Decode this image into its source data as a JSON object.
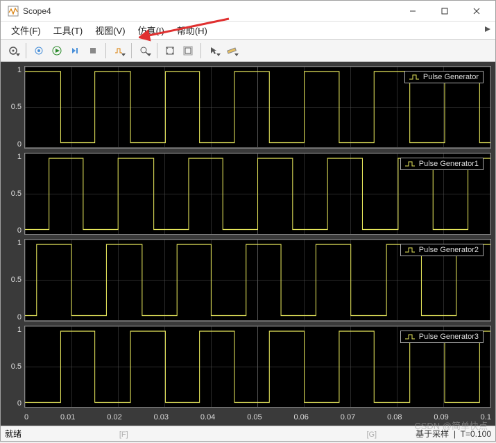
{
  "window": {
    "title": "Scope4"
  },
  "menu": {
    "file": "文件(F)",
    "tools": "工具(T)",
    "view": "视图(V)",
    "sim": "仿真(I)",
    "help": "帮助(H)"
  },
  "toolbar": {
    "config": "gear",
    "print": "print",
    "run": "run",
    "step": "step-fwd",
    "stop": "stop",
    "highlight": "highlight",
    "zoom": "zoom",
    "autoscale": "autoscale",
    "cursor": "cursor",
    "measure": "measure",
    "snapshot": "snapshot"
  },
  "status": {
    "left": "就绪",
    "right_mode": "基于采样",
    "right_time": "T=0.100"
  },
  "chart_data": [
    {
      "type": "line",
      "legend": "Pulse Generator",
      "ylim": [
        0,
        1
      ],
      "yticks": [
        0,
        0.5,
        1
      ],
      "xlim": [
        0,
        0.1
      ],
      "period": 0.015,
      "duty": 0.5,
      "phase": 0.0
    },
    {
      "type": "line",
      "legend": "Pulse Generator1",
      "ylim": [
        0,
        1
      ],
      "yticks": [
        0,
        0.5,
        1
      ],
      "xlim": [
        0,
        0.1
      ],
      "period": 0.015,
      "duty": 0.5,
      "phase": 0.005
    },
    {
      "type": "line",
      "legend": "Pulse Generator2",
      "ylim": [
        0,
        1
      ],
      "yticks": [
        0,
        0.5,
        1
      ],
      "xlim": [
        0,
        0.1
      ],
      "period": 0.015,
      "duty": 0.5,
      "phase": 0.0025
    },
    {
      "type": "line",
      "legend": "Pulse Generator3",
      "ylim": [
        0,
        1
      ],
      "yticks": [
        0,
        0.5,
        1
      ],
      "xlim": [
        0,
        0.1
      ],
      "period": 0.015,
      "duty": 0.5,
      "phase": 0.0075
    }
  ],
  "xaxis": {
    "ticks": [
      "0",
      "0.01",
      "0.02",
      "0.03",
      "0.04",
      "0.05",
      "0.06",
      "0.07",
      "0.08",
      "0.09",
      "0.1"
    ]
  },
  "watermark": "CSDN @简单快点",
  "frag": {
    "a": "[F]",
    "b": "[G]"
  }
}
